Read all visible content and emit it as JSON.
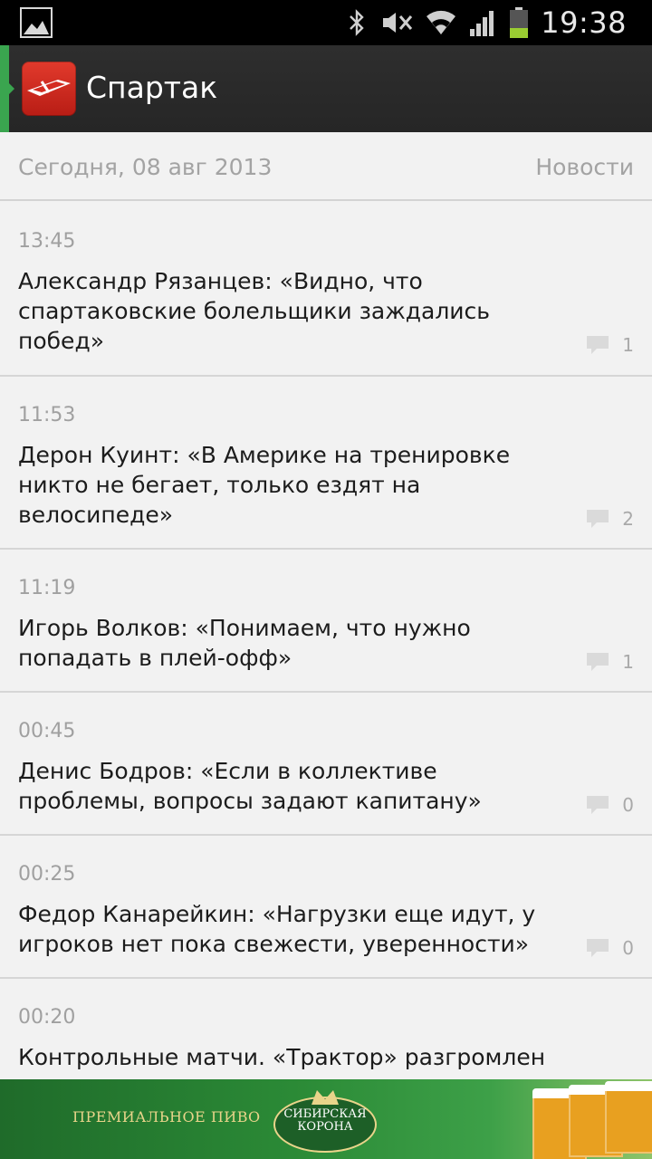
{
  "status_bar": {
    "time": "19:38",
    "icons": [
      "gallery-notification-icon",
      "bluetooth-icon",
      "mute-icon",
      "wifi-icon",
      "signal-icon",
      "battery-icon"
    ],
    "battery_color": "#9acd32"
  },
  "action_bar": {
    "title": "Спартак",
    "accent_color": "#3aa54f",
    "logo_color": "#d42b20"
  },
  "header": {
    "date": "Сегодня, 08 авг 2013",
    "section": "Новости"
  },
  "news": [
    {
      "time": "13:45",
      "title": "Александр Рязанцев: «Видно, что спартаковские болельщики заждались побед»",
      "comments": "1"
    },
    {
      "time": "11:53",
      "title": "Дерон Куинт: «В Америке на тренировке никто не бегает, только ездят на велосипеде»",
      "comments": "2"
    },
    {
      "time": "11:19",
      "title": "Игорь Волков: «Понимаем, что нужно попадать в плей-офф»",
      "comments": "1"
    },
    {
      "time": "00:45",
      "title": "Денис Бодров: «Если в коллективе проблемы, вопросы задают капитану»",
      "comments": "0"
    },
    {
      "time": "00:25",
      "title": "Федор Канарейкин: «Нагрузки еще идут, у игроков нет пока свежести, уверенности»",
      "comments": "0"
    },
    {
      "time": "00:20",
      "title": "Контрольные матчи. «Трактор» разгромлен",
      "comments": ""
    }
  ],
  "ad": {
    "tagline": "ПРЕМИАЛЬНОЕ ПИВО",
    "brand": "СИБИРСКАЯ КОРОНА",
    "bg_color": "#2b8a36"
  }
}
